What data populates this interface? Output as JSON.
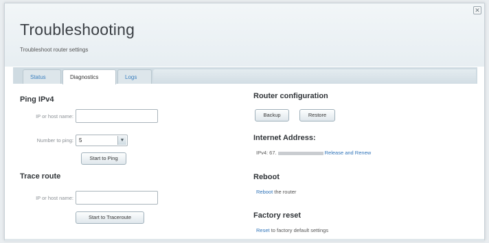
{
  "header": {
    "title": "Troubleshooting",
    "subtitle": "Troubleshoot router settings",
    "close_glyph": "✕"
  },
  "tabs": [
    {
      "label": "Status"
    },
    {
      "label": "Diagnostics"
    },
    {
      "label": "Logs"
    }
  ],
  "ping": {
    "heading": "Ping IPv4",
    "host_label": "IP or host name:",
    "host_value": "",
    "count_label": "Number to ping:",
    "count_value": "5",
    "start_button": "Start to Ping"
  },
  "trace": {
    "heading": "Trace route",
    "host_label": "IP or host name:",
    "host_value": "",
    "start_button": "Start to Traceroute"
  },
  "router_config": {
    "heading": "Router configuration",
    "backup_button": "Backup",
    "restore_button": "Restore"
  },
  "internet_address": {
    "heading": "Internet Address:",
    "ipv4_prefix": "IPv4: 67.",
    "release_link": "Release and Renew"
  },
  "reboot": {
    "heading": "Reboot",
    "link": "Reboot",
    "suffix": "the router"
  },
  "factory_reset": {
    "heading": "Factory reset",
    "link": "Reset",
    "suffix": "to factory default settings"
  },
  "icons": {
    "dropdown": "chevron-down-icon",
    "close": "close-icon"
  }
}
